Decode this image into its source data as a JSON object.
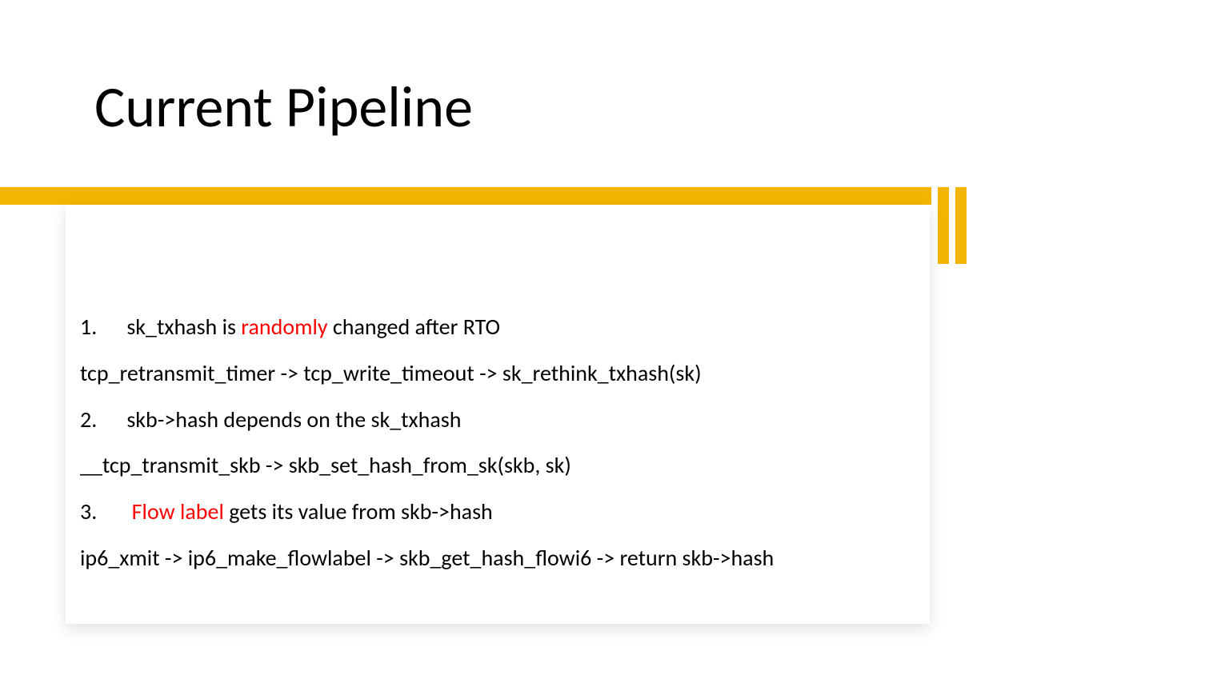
{
  "title": "Current Pipeline",
  "items": {
    "n1": "1.",
    "l1a": "sk_txhash is ",
    "l1b": "randomly",
    "l1c": " changed after RTO",
    "l1code": "tcp_retransmit_timer -> tcp_write_timeout -> sk_rethink_txhash(sk)",
    "n2": "2.",
    "l2": "skb->hash depends on the sk_txhash",
    "l2code": "__tcp_transmit_skb -> skb_set_hash_from_sk(skb, sk)",
    "n3": "3.",
    "l3a": "Flow label",
    "l3b": " gets its value from skb->hash",
    "l3code": "ip6_xmit -> ip6_make_flowlabel -> skb_get_hash_flowi6 -> return skb->hash"
  },
  "colors": {
    "accent": "#f2b600",
    "highlight": "#ff0000"
  }
}
